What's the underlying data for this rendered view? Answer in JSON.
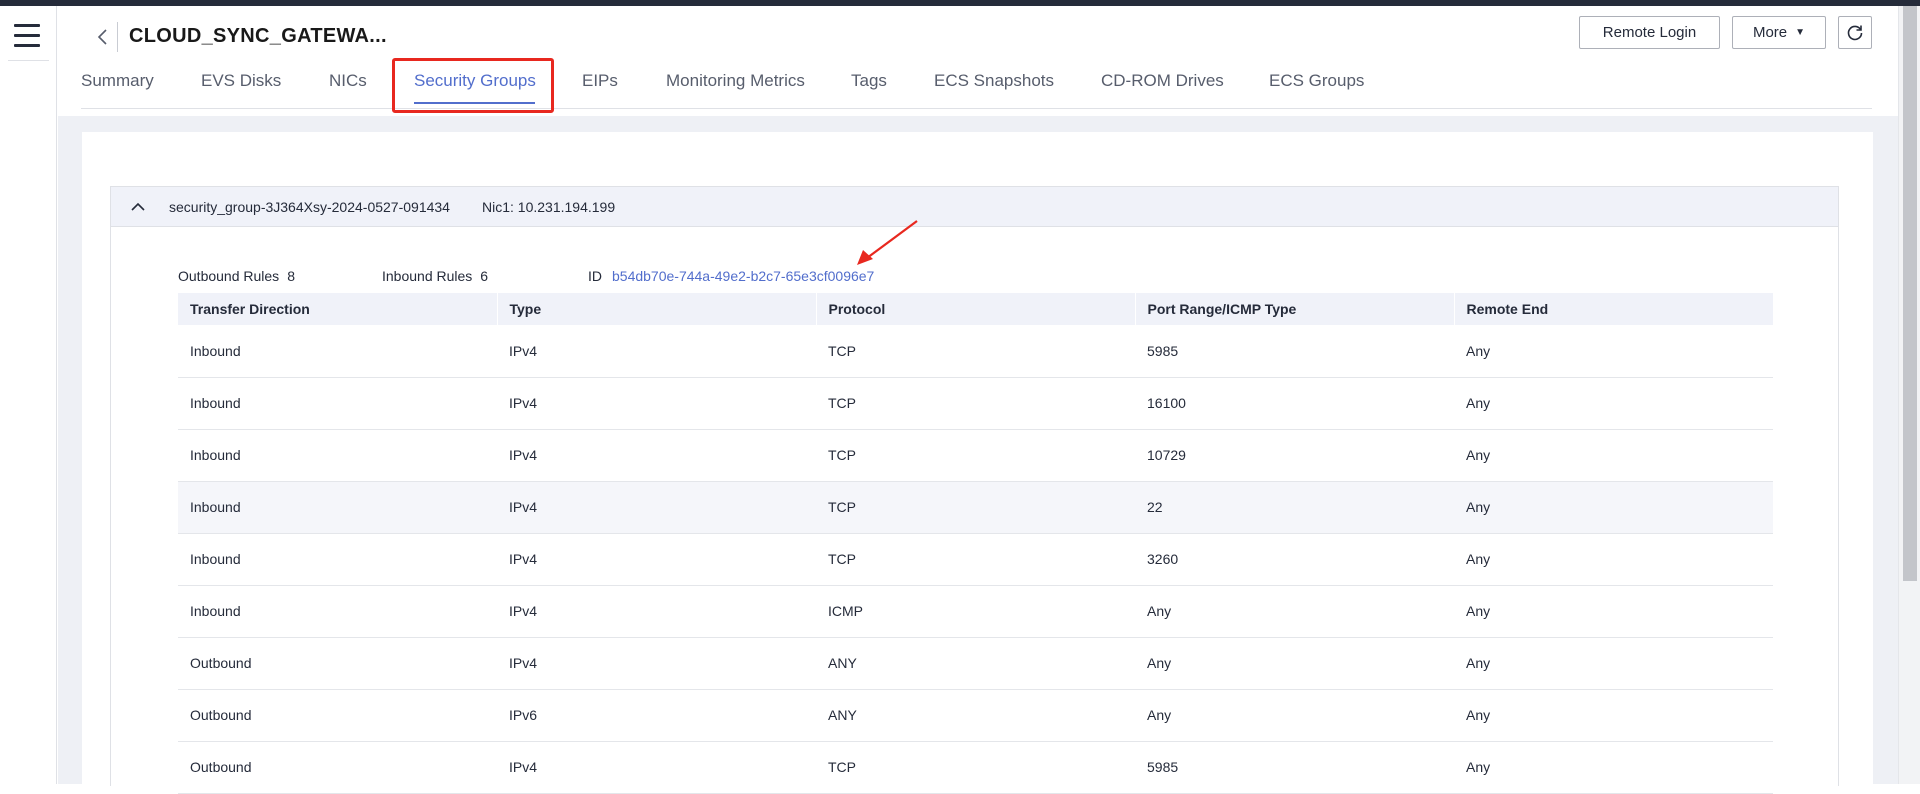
{
  "header": {
    "title": "CLOUD_SYNC_GATEWA...",
    "buttons": {
      "remote_login": "Remote Login",
      "more": "More"
    }
  },
  "tabs": [
    {
      "label": "Summary"
    },
    {
      "label": "EVS Disks"
    },
    {
      "label": "NICs"
    },
    {
      "label": "Security Groups"
    },
    {
      "label": "EIPs"
    },
    {
      "label": "Monitoring Metrics"
    },
    {
      "label": "Tags"
    },
    {
      "label": "ECS Snapshots"
    },
    {
      "label": "CD-ROM Drives"
    },
    {
      "label": "ECS Groups"
    }
  ],
  "active_tab": "Security Groups",
  "security_group": {
    "name": "security_group-3J364Xsy-2024-0527-091434",
    "nic": "Nic1: 10.231.194.199",
    "outbound_label": "Outbound Rules",
    "outbound_count": "8",
    "inbound_label": "Inbound Rules",
    "inbound_count": "6",
    "id_label": "ID",
    "id_value": "b54db70e-744a-49e2-b2c7-65e3cf0096e7"
  },
  "rules_table": {
    "columns": [
      "Transfer Direction",
      "Type",
      "Protocol",
      "Port Range/ICMP Type",
      "Remote End"
    ],
    "rows": [
      [
        "Inbound",
        "IPv4",
        "TCP",
        "5985",
        "Any"
      ],
      [
        "Inbound",
        "IPv4",
        "TCP",
        "16100",
        "Any"
      ],
      [
        "Inbound",
        "IPv4",
        "TCP",
        "10729",
        "Any"
      ],
      [
        "Inbound",
        "IPv4",
        "TCP",
        "22",
        "Any"
      ],
      [
        "Inbound",
        "IPv4",
        "TCP",
        "3260",
        "Any"
      ],
      [
        "Inbound",
        "IPv4",
        "ICMP",
        "Any",
        "Any"
      ],
      [
        "Outbound",
        "IPv4",
        "ANY",
        "Any",
        "Any"
      ],
      [
        "Outbound",
        "IPv6",
        "ANY",
        "Any",
        "Any"
      ],
      [
        "Outbound",
        "IPv4",
        "TCP",
        "5985",
        "Any"
      ]
    ],
    "hovered_row": 3
  },
  "colors": {
    "accent": "#526ecc",
    "annotation": "#e8281f",
    "text": "#252b3a"
  },
  "icons": {
    "menu": "hamburger-icon",
    "back": "chevron-left-icon",
    "more_caret": "caret-down-icon",
    "refresh": "refresh-icon",
    "collapse": "chevron-up-icon"
  }
}
